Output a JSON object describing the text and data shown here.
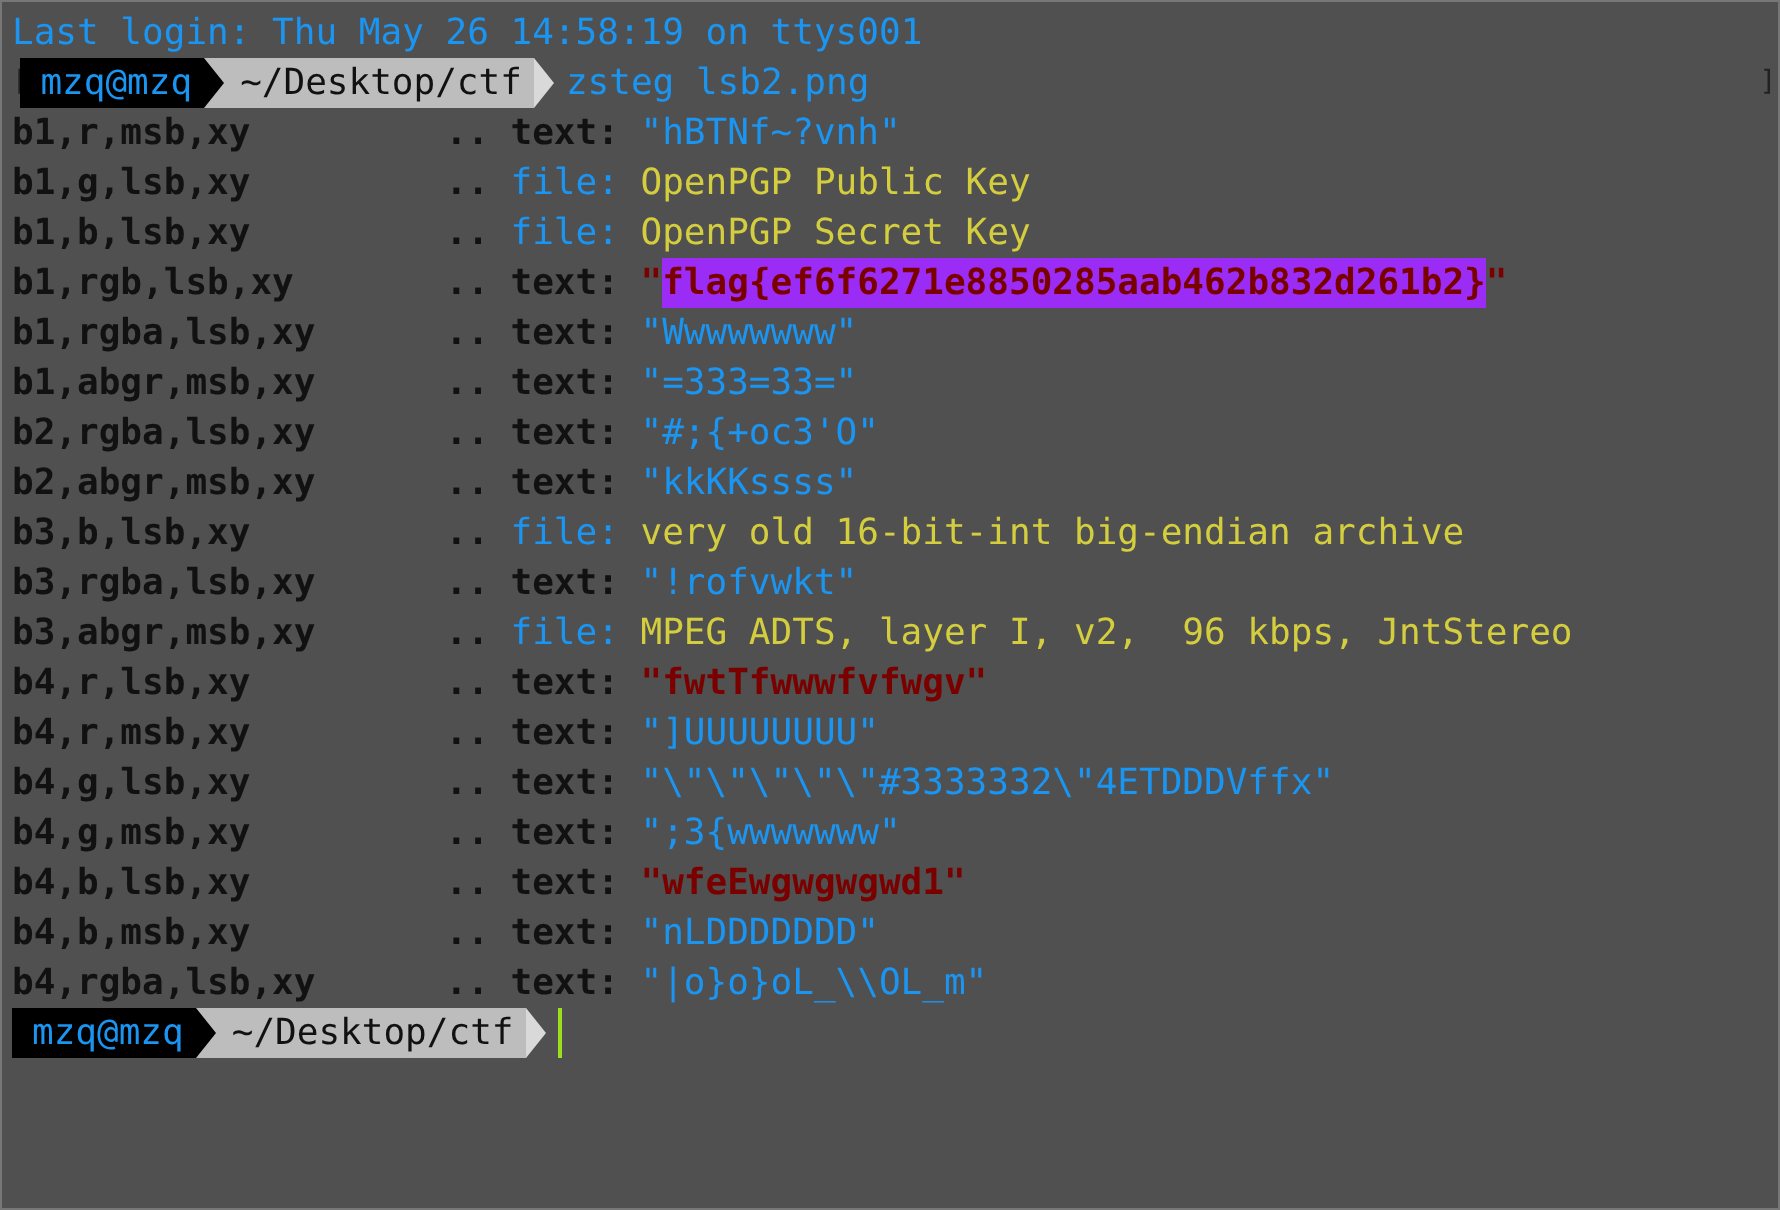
{
  "last_login": "Last login: Thu May 26 14:58:19 on ttys001",
  "prompts": [
    {
      "bracket_left": "[",
      "user": "mzq@mzq",
      "path": "~/Desktop/ctf",
      "command": "zsteg lsb2.png",
      "bracket_right": "]"
    },
    {
      "user": "mzq@mzq",
      "path": "~/Desktop/ctf",
      "cursor": true
    }
  ],
  "results": [
    {
      "label": "b1,r,msb,xy",
      "separator": "..",
      "kind": "text",
      "tag": "text:",
      "value": "\"hBTNf~?vnh\"",
      "bold": false,
      "highlighted": false
    },
    {
      "label": "b1,g,lsb,xy",
      "separator": "..",
      "kind": "file",
      "tag": "file:",
      "value": "OpenPGP Public Key",
      "bold": false,
      "highlighted": false
    },
    {
      "label": "b1,b,lsb,xy",
      "separator": "..",
      "kind": "file",
      "tag": "file:",
      "value": "OpenPGP Secret Key",
      "bold": false,
      "highlighted": false
    },
    {
      "label": "b1,rgb,lsb,xy",
      "separator": "..",
      "kind": "text",
      "tag": "text:",
      "quote_open": "\"",
      "value": "flag{ef6f6271e8850285aab462b832d261b2}",
      "quote_close": "\"",
      "bold": true,
      "highlighted": true
    },
    {
      "label": "b1,rgba,lsb,xy",
      "separator": "..",
      "kind": "text",
      "tag": "text:",
      "value": "\"Wwwwwwww\"",
      "bold": false,
      "highlighted": false
    },
    {
      "label": "b1,abgr,msb,xy",
      "separator": "..",
      "kind": "text",
      "tag": "text:",
      "value": "\"=333=33=\"",
      "bold": false,
      "highlighted": false
    },
    {
      "label": "b2,rgba,lsb,xy",
      "separator": "..",
      "kind": "text",
      "tag": "text:",
      "value": "\"#;{+oc3'O\"",
      "bold": false,
      "highlighted": false
    },
    {
      "label": "b2,abgr,msb,xy",
      "separator": "..",
      "kind": "text",
      "tag": "text:",
      "value": "\"kkKKssss\"",
      "bold": false,
      "highlighted": false
    },
    {
      "label": "b3,b,lsb,xy",
      "separator": "..",
      "kind": "file",
      "tag": "file:",
      "value": "very old 16-bit-int big-endian archive",
      "bold": false,
      "highlighted": false
    },
    {
      "label": "b3,rgba,lsb,xy",
      "separator": "..",
      "kind": "text",
      "tag": "text:",
      "value": "\"!rofvwkt\"",
      "bold": false,
      "highlighted": false
    },
    {
      "label": "b3,abgr,msb,xy",
      "separator": "..",
      "kind": "file",
      "tag": "file:",
      "value": "MPEG ADTS, layer I, v2,  96 kbps, JntStereo",
      "bold": false,
      "highlighted": false
    },
    {
      "label": "b4,r,lsb,xy",
      "separator": "..",
      "kind": "text",
      "tag": "text:",
      "value": "\"fwtTfwwwfvfwgv\"",
      "bold": true,
      "highlighted": false
    },
    {
      "label": "b4,r,msb,xy",
      "separator": "..",
      "kind": "text",
      "tag": "text:",
      "value": "\"]UUUUUUUU\"",
      "bold": false,
      "highlighted": false
    },
    {
      "label": "b4,g,lsb,xy",
      "separator": "..",
      "kind": "text",
      "tag": "text:",
      "value": "\"\\\"\\\"\\\"\\\"\\\"#3333332\\\"4ETDDDVffx\"",
      "bold": false,
      "highlighted": false
    },
    {
      "label": "b4,g,msb,xy",
      "separator": "..",
      "kind": "text",
      "tag": "text:",
      "value": "\";3{wwwwwww\"",
      "bold": false,
      "highlighted": false
    },
    {
      "label": "b4,b,lsb,xy",
      "separator": "..",
      "kind": "text",
      "tag": "text:",
      "value": "\"wfeEwgwgwgwd1\"",
      "bold": true,
      "highlighted": false
    },
    {
      "label": "b4,b,msb,xy",
      "separator": "..",
      "kind": "text",
      "tag": "text:",
      "value": "\"nLDDDDDDD\"",
      "bold": false,
      "highlighted": false
    },
    {
      "label": "b4,rgba,lsb,xy",
      "separator": "..",
      "kind": "text",
      "tag": "text:",
      "value": "\"|o}o}oL_\\\\OL_m\"",
      "bold": false,
      "highlighted": false
    }
  ]
}
